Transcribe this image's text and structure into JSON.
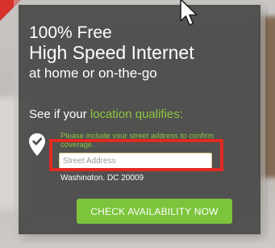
{
  "card": {
    "headline_line1": "100% Free",
    "headline_line2": "High Speed Internet",
    "headline_line3": "at home or on-the-go",
    "qualify_prefix": "See if your ",
    "qualify_accent": "location qualifies:",
    "helper_text": "Please include your street address to confirm coverage.",
    "address_placeholder": "Street Address",
    "address_value": "",
    "city_state_zip": "Washington, DC 20009",
    "cta_label": "CHECK AVAILABILITY NOW"
  },
  "colors": {
    "accent": "#8dc63f",
    "button": "#7cc43b",
    "highlight": "#e02a22",
    "panel": "#484848"
  },
  "icons": {
    "location": "location-check-icon",
    "cursor": "mouse-pointer-icon"
  }
}
